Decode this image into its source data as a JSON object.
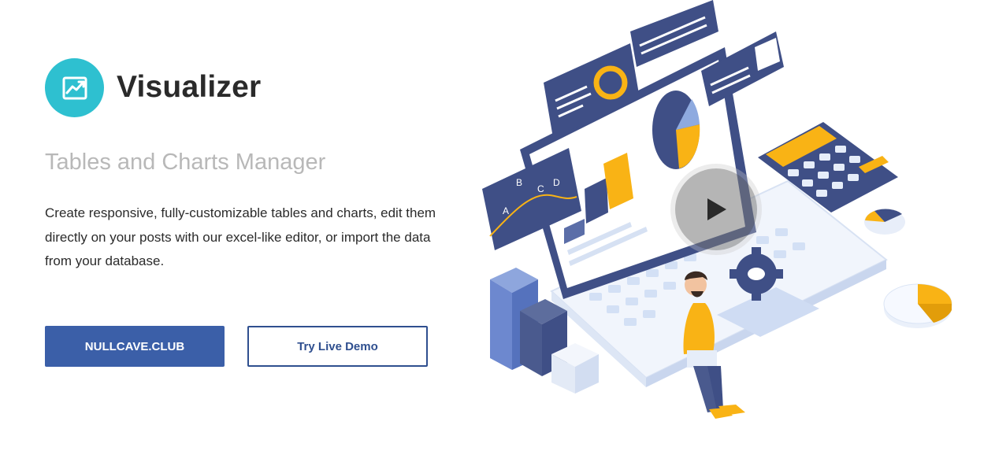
{
  "brand": {
    "name": "Visualizer",
    "logo_icon": "chart-trend-icon",
    "logo_color": "#2ec0d0"
  },
  "hero": {
    "subtitle": "Tables and Charts Manager",
    "description": "Create responsive, fully-customizable tables and charts, edit them directly on your posts with our excel-like editor, or import the data from your database."
  },
  "buttons": {
    "primary_label": "NULLCAVE.CLUB",
    "secondary_label": "Try Live Demo"
  },
  "illustration": {
    "chart_letters": [
      "A",
      "B",
      "C",
      "D"
    ],
    "play_icon": "play-icon"
  },
  "colors": {
    "primary": "#3b5fa8",
    "accent": "#f9b315",
    "navy": "#3f4f86"
  }
}
